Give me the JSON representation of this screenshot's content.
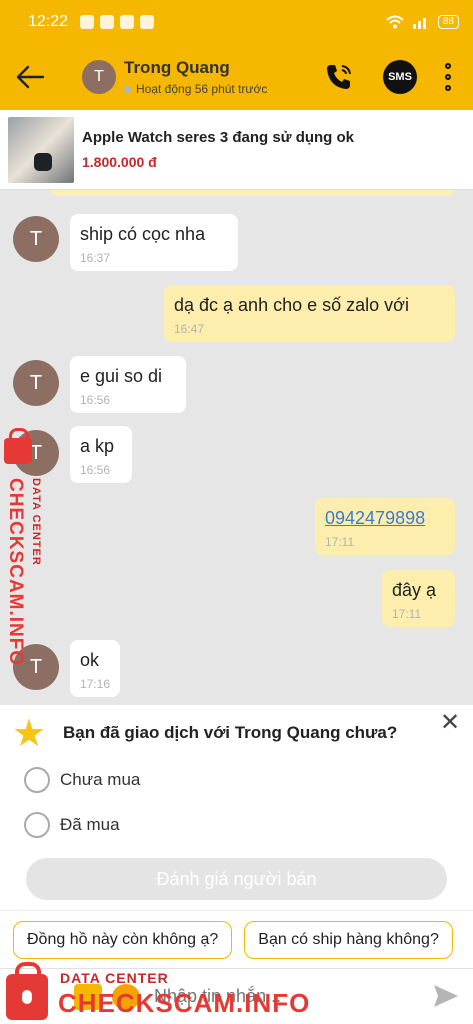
{
  "status_bar": {
    "time": "12:22",
    "battery": "88"
  },
  "header": {
    "avatar_letter": "T",
    "name": "Trong Quang",
    "status": "Hoạt động 56 phút trước",
    "sms_label": "SMS"
  },
  "product": {
    "title": "Apple Watch seres 3 đang sử dụng ok",
    "price": "1.800.000 đ"
  },
  "messages": [
    {
      "dir": "in",
      "text": "ship có cọc nha",
      "time": "16:37"
    },
    {
      "dir": "out",
      "text": "dạ đc ạ anh cho e số zalo với",
      "time": "16:47"
    },
    {
      "dir": "in",
      "text": "e gui so di",
      "time": "16:56"
    },
    {
      "dir": "in",
      "text": "a kp",
      "time": "16:56"
    },
    {
      "dir": "out",
      "text": "0942479898",
      "time": "17:11"
    },
    {
      "dir": "out",
      "text": "đây ạ",
      "time": "17:11"
    },
    {
      "dir": "in",
      "text": "ok",
      "time": "17:16"
    }
  ],
  "survey": {
    "question": "Bạn đã giao dịch với Trong Quang chưa?",
    "options": [
      "Chưa mua",
      "Đã mua"
    ],
    "rate_button": "Đánh giá người bán"
  },
  "quick_replies": [
    "Đồng hồ này còn không ạ?",
    "Bạn có ship hàng không?"
  ],
  "input": {
    "placeholder": "Nhập tin nhắn..."
  },
  "watermark": {
    "small": "DATA CENTER",
    "big": "CHECKSCAM.INFO"
  },
  "colors": {
    "brand": "#f5b700",
    "outgoing_bubble": "#fdeeae",
    "price": "#c62828",
    "watermark": "#e53935"
  }
}
